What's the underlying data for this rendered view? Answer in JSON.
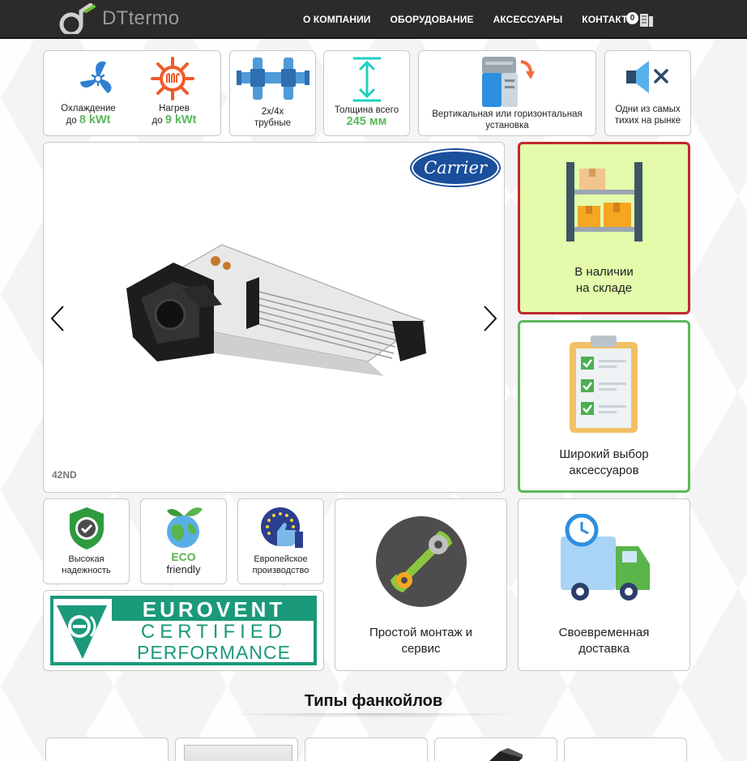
{
  "header": {
    "logo_text": "DTtermo",
    "nav": [
      "О КОМПАНИИ",
      "ОБОРУДОВАНИЕ",
      "АКСЕССУАРЫ",
      "КОНТАКТЫ"
    ],
    "cart_count": "0"
  },
  "features": {
    "cooling": {
      "label": "Охлаждение",
      "prefix": "до",
      "value": "8 kWt"
    },
    "heating": {
      "label": "Нагрев",
      "prefix": "до",
      "value": "9 kWt"
    },
    "pipes": {
      "line1": "2х/4х",
      "line2": "трубные"
    },
    "thickness": {
      "label": "Толщина всего",
      "value": "245 мм"
    },
    "install": {
      "line1": "Вертикальная или горизонтальная",
      "line2": "установка"
    },
    "quiet": {
      "line1": "Одни из самых",
      "line2": "тихих на рынке"
    }
  },
  "slider": {
    "brand": "Carrier",
    "caption": "42ND"
  },
  "side_cards": {
    "stock": {
      "line1": "В наличии",
      "line2": "на складе"
    },
    "accessories": {
      "line1": "Широкий выбор",
      "line2": "аксессуаров"
    }
  },
  "bottom_features": {
    "reliability": {
      "line1": "Высокая",
      "line2": "надежность"
    },
    "eco": {
      "line1": "ECO",
      "line2": "friendly"
    },
    "european": {
      "line1": "Европейское",
      "line2": "производство"
    },
    "eurovent": {
      "line1": "EUROVENT",
      "line2": "CERTIFIED",
      "line3": "PERFORMANCE"
    },
    "install": {
      "line1": "Простой монтаж и",
      "line2": "сервис"
    },
    "delivery": {
      "line1": "Своевременная",
      "line2": "доставка"
    }
  },
  "section_title": "Типы фанкойлов",
  "colors": {
    "header_bg": "#2b2b2b",
    "accent_green": "#5cb85c",
    "stock_bg": "#e3fbaa",
    "stock_border": "#c0282d",
    "accessories_border": "#5cb85c",
    "eurovent_green": "#1a9a7a"
  }
}
